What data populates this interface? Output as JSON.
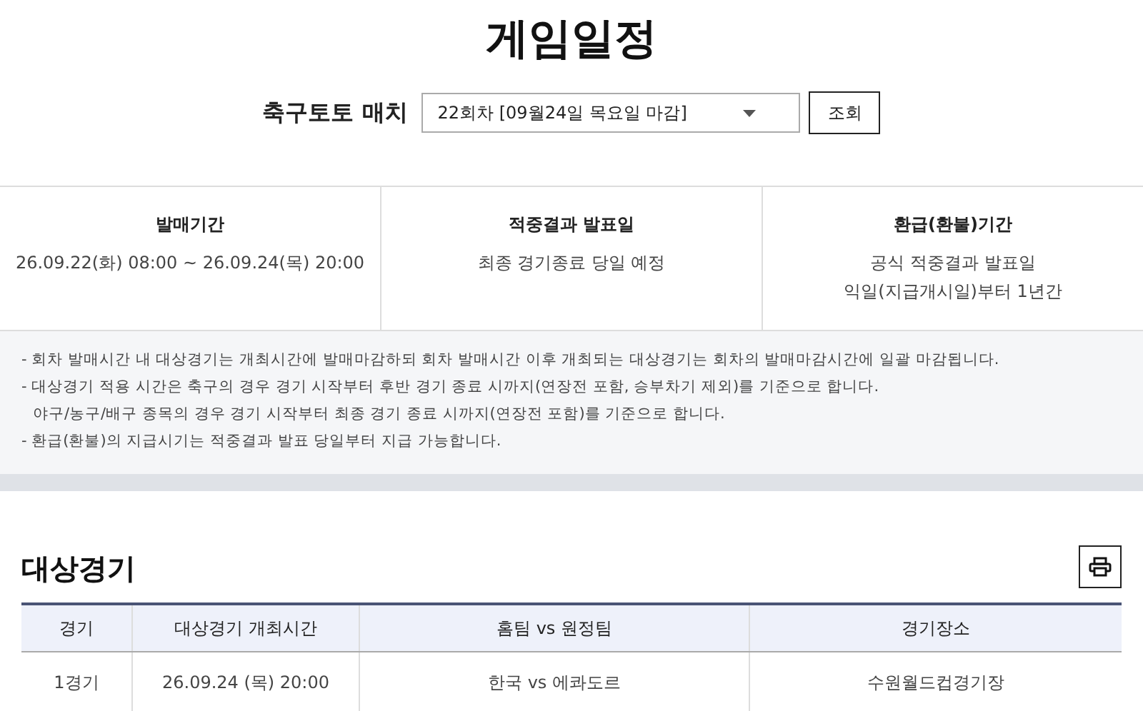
{
  "title": "게임일정",
  "selector": {
    "label": "축구토토 매치",
    "value": "22회차 [09월24일 목요일 마감]",
    "button": "조회"
  },
  "info": [
    {
      "heading": "발매기간",
      "lines": [
        "26.09.22(화) 08:00 ~ 26.09.24(목) 20:00"
      ]
    },
    {
      "heading": "적중결과 발표일",
      "lines": [
        "최종 경기종료 당일 예정"
      ]
    },
    {
      "heading": "환급(환불)기간",
      "lines": [
        "공식 적중결과 발표일",
        "익일(지급개시일)부터 1년간"
      ]
    }
  ],
  "notes": [
    {
      "lines": [
        "- 회차 발매시간 내 대상경기는 개최시간에 발매마감하되 회차 발매시간 이후 개최되는 대상경기는 회차의 발매마감시간에 일괄 마감됩니다."
      ]
    },
    {
      "lines": [
        "- 대상경기 적용 시간은 축구의 경우 경기 시작부터 후반 경기 종료 시까지(연장전 포함, 승부차기 제외)를 기준으로 합니다.",
        "야구/농구/배구 종목의 경우 경기 시작부터 최종 경기 종료 시까지(연장전 포함)를 기준으로 합니다."
      ]
    },
    {
      "lines": [
        "- 환급(환불)의 지급시기는 적중결과 발표 당일부터 지급 가능합니다."
      ]
    }
  ],
  "section": {
    "title": "대상경기"
  },
  "table": {
    "columns": [
      "경기",
      "대상경기 개최시간",
      "홈팀  vs  원정팀",
      "경기장소"
    ],
    "rows": [
      [
        "1경기",
        "26.09.24 (목) 20:00",
        "한국  vs  에콰도르",
        "수원월드컵경기장"
      ]
    ]
  }
}
